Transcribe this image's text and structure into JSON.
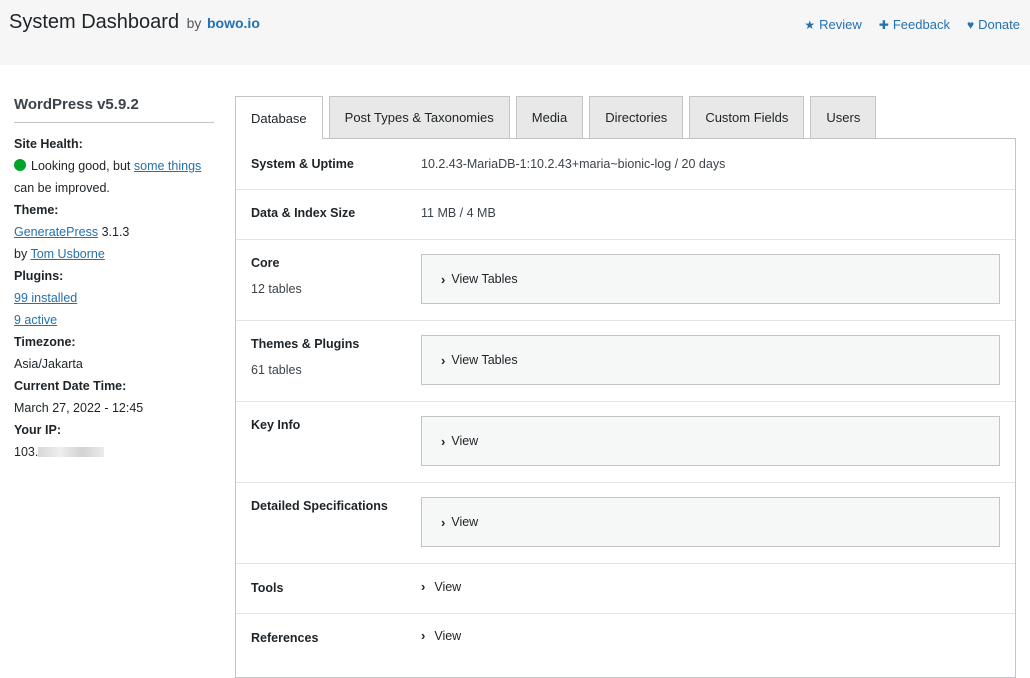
{
  "header": {
    "title": "System Dashboard",
    "by": "by",
    "brand": "bowo.io",
    "links": [
      {
        "icon": "star-icon",
        "glyph": "★",
        "label": "Review"
      },
      {
        "icon": "plus-icon",
        "glyph": "✚",
        "label": "Feedback"
      },
      {
        "icon": "heart-icon",
        "glyph": "♥",
        "label": "Donate"
      }
    ]
  },
  "sidebar": {
    "wp_version": "WordPress v5.9.2",
    "site_health_label": "Site Health:",
    "site_health_status_color": "#00a32a",
    "site_health_text": "Looking good, but",
    "site_health_link": "some things",
    "site_health_text2": "can be improved.",
    "theme_label": "Theme:",
    "theme_name": "GeneratePress",
    "theme_version": "3.1.3",
    "theme_by": "by",
    "theme_author": "Tom Usborne",
    "plugins_label": "Plugins:",
    "plugins_installed": "99 installed",
    "plugins_active": "9 active",
    "timezone_label": "Timezone:",
    "timezone_value": "Asia/Jakarta",
    "datetime_label": "Current Date Time:",
    "datetime_value": "March 27, 2022 - 12:45",
    "ip_label": "Your IP:",
    "ip_value": "103."
  },
  "tabs": [
    {
      "label": "Database",
      "active": true
    },
    {
      "label": "Post Types & Taxonomies",
      "active": false
    },
    {
      "label": "Media",
      "active": false
    },
    {
      "label": "Directories",
      "active": false
    },
    {
      "label": "Custom Fields",
      "active": false
    },
    {
      "label": "Users",
      "active": false
    }
  ],
  "database": {
    "system_uptime_label": "System & Uptime",
    "system_uptime_value": "10.2.43-MariaDB-1:10.2.43+maria~bionic-log / 20 days",
    "data_index_label": "Data & Index Size",
    "data_index_value": "11 MB / 4 MB",
    "core_label": "Core",
    "core_count": "12 tables",
    "core_toggle": "View Tables",
    "themes_plugins_label": "Themes & Plugins",
    "themes_plugins_count": "61 tables",
    "themes_plugins_toggle": "View Tables",
    "key_info_label": "Key Info",
    "key_info_toggle": "View",
    "detailed_specs_label": "Detailed Specifications",
    "detailed_specs_toggle": "View",
    "tools_label": "Tools",
    "tools_toggle": "View",
    "references_label": "References",
    "references_toggle": "View",
    "chevron_glyph": "›"
  }
}
